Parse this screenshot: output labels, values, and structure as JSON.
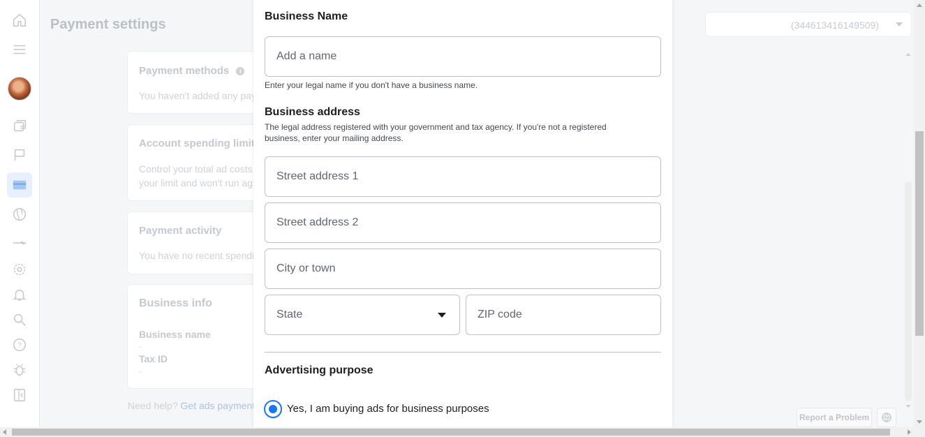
{
  "page": {
    "title": "Payment settings",
    "account_id": "(344613416149509)"
  },
  "cards": {
    "payment_methods": {
      "title": "Payment methods",
      "text": "You haven't added any pay"
    },
    "spending_limit": {
      "title": "Account spending limit",
      "text_line1": "Control your total ad costs",
      "text_line2": "your limit and won't run ag"
    },
    "payment_activity": {
      "title": "Payment activity",
      "text": "You have no recent spendi"
    },
    "business_info": {
      "title": "Business info",
      "name_label": "Business name",
      "name_value": "-",
      "tax_label": "Tax ID",
      "tax_value": "-"
    }
  },
  "help": {
    "prefix": "Need help?",
    "link": "Get ads payment"
  },
  "footer": {
    "report_button": "Report a Problem"
  },
  "sidebar": {
    "icons": [
      "home-icon",
      "menu-icon",
      "avatar",
      "campaigns-icon",
      "flag-icon",
      "billing-icon",
      "globe-icon",
      "tools-icon",
      "settings-icon",
      "notifications-icon",
      "search-icon",
      "help-icon",
      "bug-icon",
      "collapse-icon"
    ],
    "active": "billing-icon"
  },
  "modal": {
    "business_name": {
      "heading": "Business Name",
      "placeholder": "Add a name",
      "helper": "Enter your legal name if you don't have a business name."
    },
    "business_address": {
      "heading": "Business address",
      "helper_line1": "The legal address registered with your government and tax agency. If you're not a registered",
      "helper_line2": "business, enter your mailing address.",
      "street1_placeholder": "Street address 1",
      "street2_placeholder": "Street address 2",
      "city_placeholder": "City or town",
      "state_label": "State",
      "zip_placeholder": "ZIP code"
    },
    "advertising_purpose": {
      "heading": "Advertising purpose",
      "option_business": "Yes, I am buying ads for business purposes",
      "selected": "business"
    }
  },
  "colors": {
    "accent": "#1877f2",
    "text_primary": "#1c1e21",
    "field_border": "#bec3c9"
  }
}
